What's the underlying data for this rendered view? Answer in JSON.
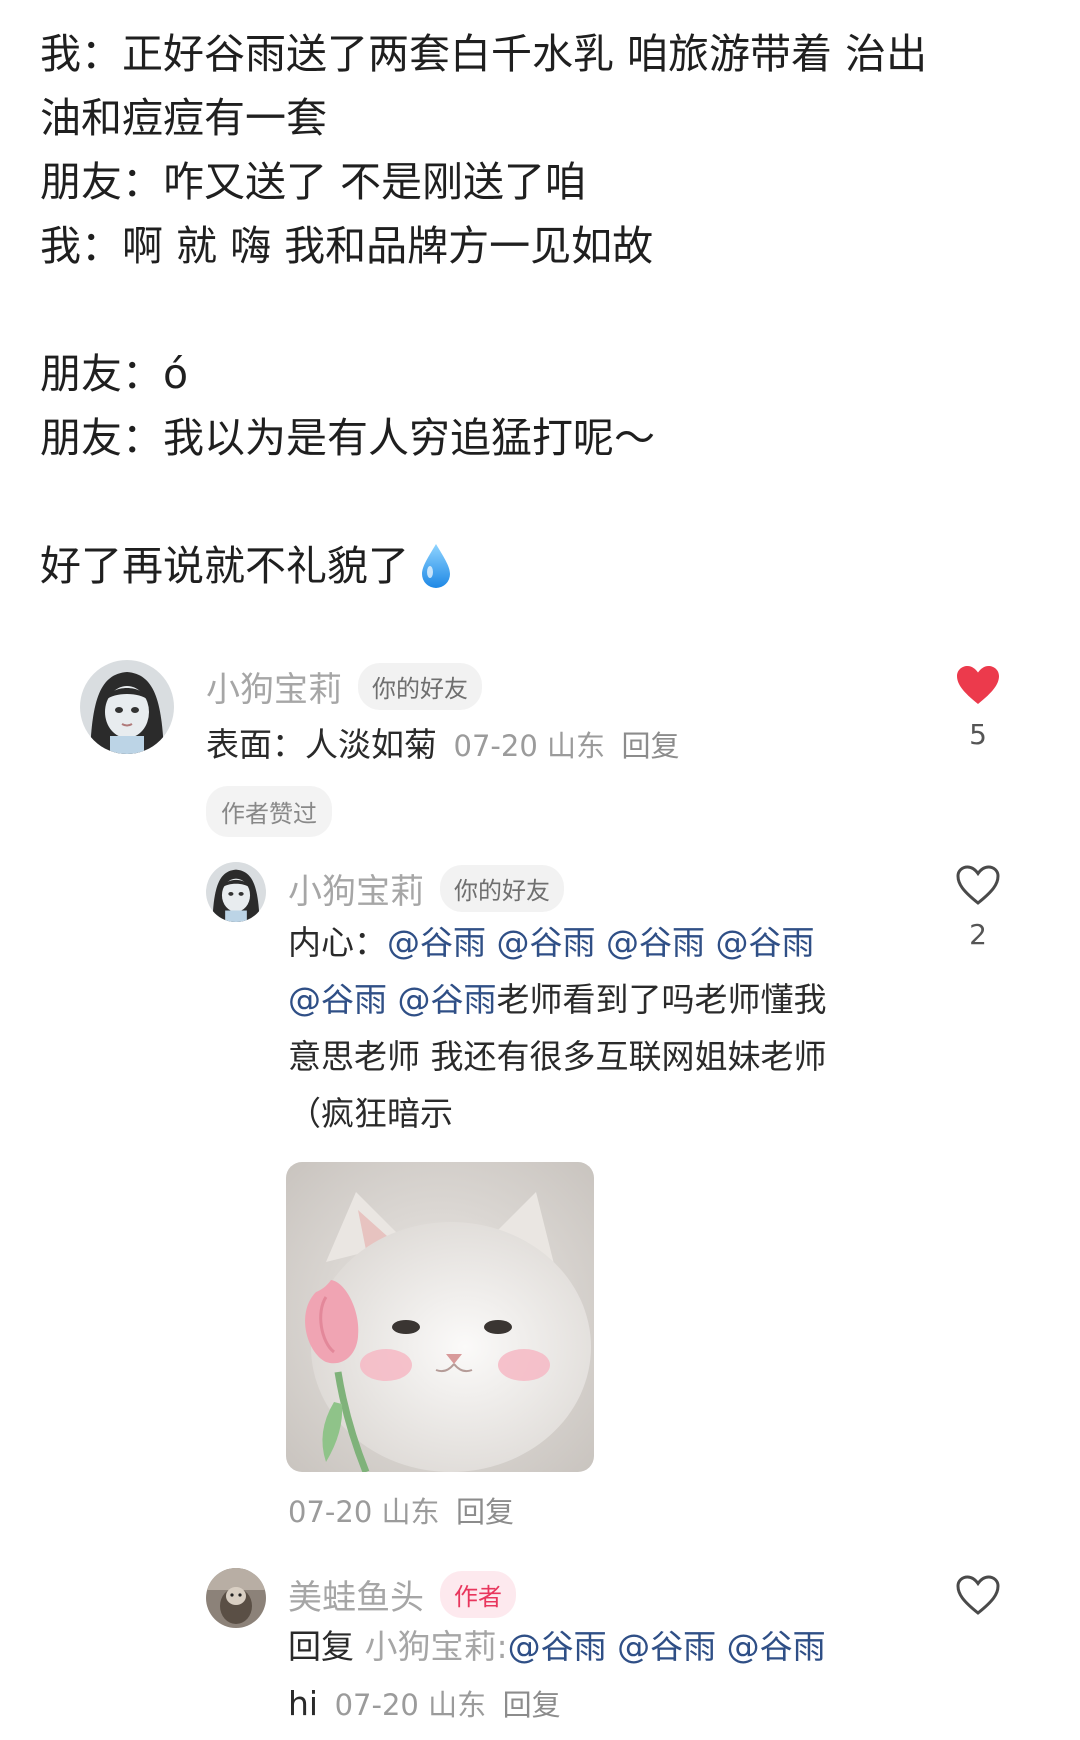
{
  "post": {
    "lines": [
      "我：正好谷雨送了两套白千水乳 咱旅游带着 治出",
      "油和痘痘有一套",
      "朋友：咋又送了 不是刚送了咱",
      "我：啊 就 嗨 我和品牌方一见如故",
      "",
      "朋友：ó",
      "朋友：我以为是有人穷追猛打呢～",
      "",
      "好了再说就不礼貌了"
    ],
    "end_emoji": "water-drop-icon"
  },
  "comments": {
    "c1": {
      "user": "小狗宝莉",
      "badge": "你的好友",
      "text": "表面：人淡如菊",
      "meta": "07-20 山东",
      "reply_label": "回复",
      "author_liked": "作者赞过",
      "likes": "5",
      "liked": true
    },
    "c2": {
      "user": "小狗宝莉",
      "badge": "你的好友",
      "prefix": "内心：",
      "mentions": [
        "@谷雨",
        "@谷雨",
        "@谷雨",
        "@谷雨",
        "@谷雨",
        "@谷雨"
      ],
      "line2_rest": "老师看到了吗老师懂我",
      "line3": "意思老师 我还有很多互联网姐妹老师",
      "line4": "（疯狂暗示",
      "meta": "07-20 山东",
      "reply_label": "回复",
      "likes": "2",
      "liked": false
    },
    "c3": {
      "user": "美蛙鱼头",
      "badge": "作者",
      "reply_prefix": "回复",
      "reply_target": "小狗宝莉:",
      "mentions": [
        "@谷雨",
        "@谷雨",
        "@谷雨"
      ],
      "line2": "hi",
      "meta": "07-20 山东",
      "reply_label": "回复",
      "liked": false
    }
  },
  "colors": {
    "like_red": "#ec3a4c",
    "mention_blue": "#2f4f86",
    "author_badge": "#e8365d"
  }
}
